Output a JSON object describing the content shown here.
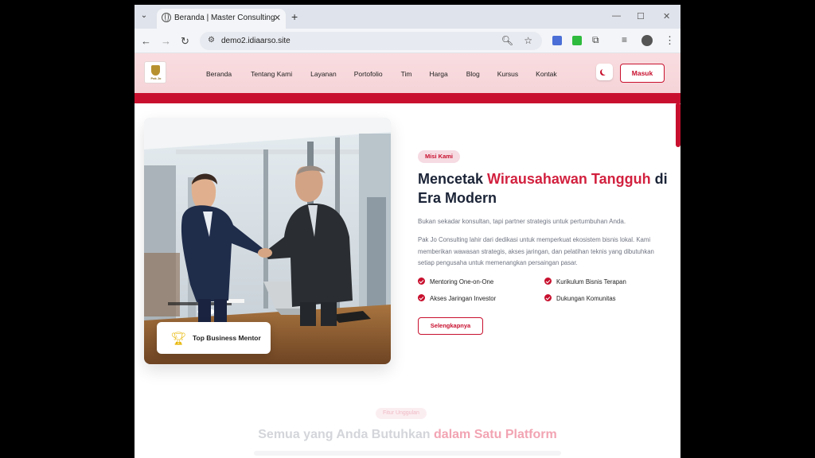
{
  "browser": {
    "tab_title": "Beranda | Master Consulting",
    "url": "demo2.idiaarso.site",
    "new_tab": "+",
    "close_tab": "✕"
  },
  "nav": {
    "menu": [
      "Beranda",
      "Tentang Kami",
      "Layanan",
      "Portofolio",
      "Tim",
      "Harga",
      "Blog",
      "Kursus",
      "Kontak"
    ],
    "login_label": "Masuk"
  },
  "hero": {
    "badge_card": "Top Business Mentor",
    "mission_pill": "Misi Kami",
    "title_part1": "Mencetak ",
    "title_accent": "Wirausahawan Tangguh",
    "title_part2": " di Era Modern",
    "lead": "Bukan sekadar konsultan, tapi partner strategis untuk pertumbuhan Anda.",
    "paragraph": "Pak Jo Consulting lahir dari dedikasi untuk memperkuat ekosistem bisnis lokal. Kami memberikan wawasan strategis, akses jaringan, dan pelatihan teknis yang dibutuhkan setiap pengusaha untuk memenangkan persaingan pasar.",
    "features": [
      "Mentoring One-on-One",
      "Kurikulum Bisnis Terapan",
      "Akses Jaringan Investor",
      "Dukungan Komunitas"
    ],
    "cta": "Selengkapnya"
  },
  "section": {
    "pill": "Fitur Unggulan",
    "title_part1": "Semua yang Anda Butuhkan ",
    "title_accent": "dalam Satu Platform"
  },
  "colors": {
    "accent": "#c8102e",
    "heading": "#1b2437",
    "nav_bg": "#f8d9dd"
  }
}
